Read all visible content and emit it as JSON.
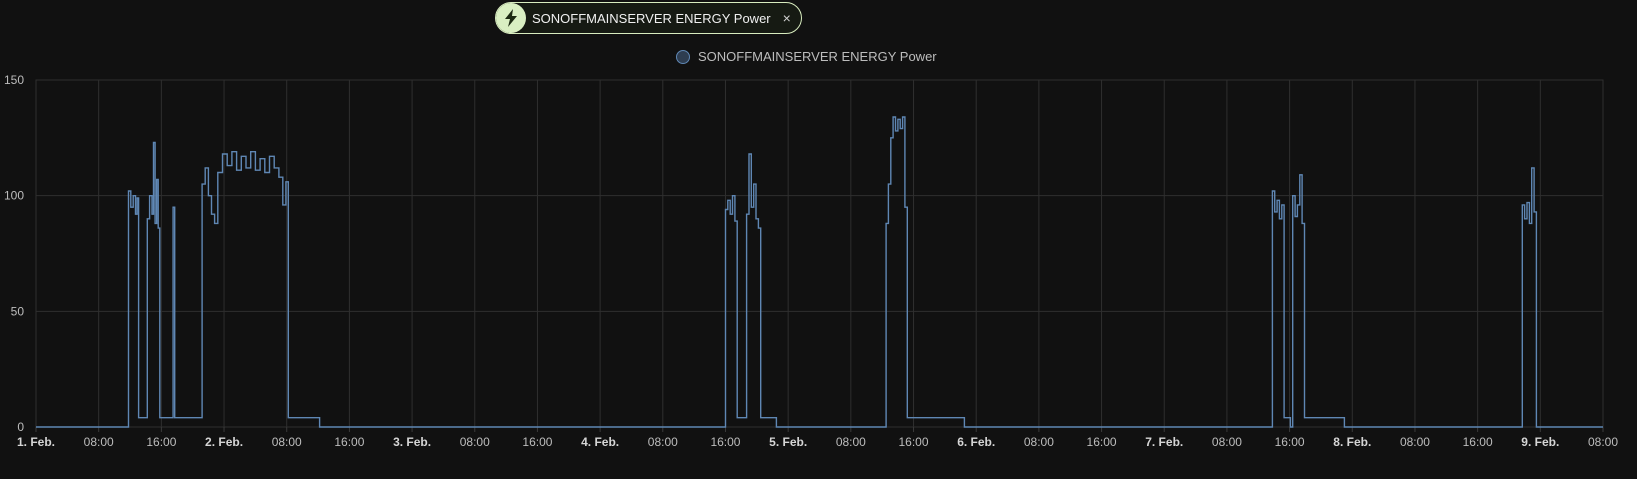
{
  "filter_chip": {
    "label": "SONOFFMAINSERVER ENERGY Power",
    "icon": "flash-icon",
    "close_label": "×",
    "accent_color": "#d9efc2"
  },
  "chart_data": {
    "type": "line",
    "step": true,
    "grid": true,
    "legend_position": "top-center",
    "ylim": [
      0,
      150
    ],
    "yticks": [
      0,
      50,
      100,
      150
    ],
    "x_unit": "hours since start of 1. Feb.",
    "xlim": [
      0,
      200
    ],
    "xticks": [
      {
        "x": 0,
        "label": "1. Feb.",
        "major": true
      },
      {
        "x": 8,
        "label": "08:00"
      },
      {
        "x": 16,
        "label": "16:00"
      },
      {
        "x": 24,
        "label": "2. Feb.",
        "major": true
      },
      {
        "x": 32,
        "label": "08:00"
      },
      {
        "x": 40,
        "label": "16:00"
      },
      {
        "x": 48,
        "label": "3. Feb.",
        "major": true
      },
      {
        "x": 56,
        "label": "08:00"
      },
      {
        "x": 64,
        "label": "16:00"
      },
      {
        "x": 72,
        "label": "4. Feb.",
        "major": true
      },
      {
        "x": 80,
        "label": "08:00"
      },
      {
        "x": 88,
        "label": "16:00"
      },
      {
        "x": 96,
        "label": "5. Feb.",
        "major": true
      },
      {
        "x": 104,
        "label": "08:00"
      },
      {
        "x": 112,
        "label": "16:00"
      },
      {
        "x": 120,
        "label": "6. Feb.",
        "major": true
      },
      {
        "x": 128,
        "label": "08:00"
      },
      {
        "x": 136,
        "label": "16:00"
      },
      {
        "x": 144,
        "label": "7. Feb.",
        "major": true
      },
      {
        "x": 152,
        "label": "08:00"
      },
      {
        "x": 160,
        "label": "16:00"
      },
      {
        "x": 168,
        "label": "8. Feb.",
        "major": true
      },
      {
        "x": 176,
        "label": "08:00"
      },
      {
        "x": 184,
        "label": "16:00"
      },
      {
        "x": 192,
        "label": "9. Feb.",
        "major": true
      },
      {
        "x": 200,
        "label": "08:00"
      }
    ],
    "series": [
      {
        "name": "SONOFFMAINSERVER ENERGY Power",
        "color": "#5f87b4",
        "points": [
          [
            0,
            0
          ],
          [
            11.8,
            0
          ],
          [
            11.8,
            102
          ],
          [
            12.1,
            95
          ],
          [
            12.4,
            100
          ],
          [
            12.7,
            92
          ],
          [
            12.9,
            99
          ],
          [
            13.1,
            4
          ],
          [
            14.2,
            4
          ],
          [
            14.2,
            90
          ],
          [
            14.5,
            100
          ],
          [
            14.8,
            92
          ],
          [
            15.0,
            123
          ],
          [
            15.2,
            88
          ],
          [
            15.4,
            107
          ],
          [
            15.6,
            86
          ],
          [
            15.8,
            4
          ],
          [
            17.5,
            4
          ],
          [
            17.5,
            95
          ],
          [
            17.7,
            4
          ],
          [
            21.2,
            4
          ],
          [
            21.2,
            105
          ],
          [
            21.6,
            112
          ],
          [
            22.0,
            100
          ],
          [
            22.4,
            92
          ],
          [
            22.8,
            88
          ],
          [
            23.2,
            110
          ],
          [
            23.8,
            118
          ],
          [
            24.4,
            113
          ],
          [
            25.0,
            119
          ],
          [
            25.6,
            111
          ],
          [
            26.2,
            117
          ],
          [
            26.8,
            112
          ],
          [
            27.4,
            119
          ],
          [
            28.0,
            111
          ],
          [
            28.6,
            116
          ],
          [
            29.2,
            110
          ],
          [
            29.8,
            117
          ],
          [
            30.4,
            112
          ],
          [
            31.0,
            108
          ],
          [
            31.5,
            96
          ],
          [
            31.9,
            106
          ],
          [
            32.2,
            4
          ],
          [
            36.2,
            4
          ],
          [
            36.2,
            0
          ],
          [
            88.0,
            0
          ],
          [
            88.0,
            94
          ],
          [
            88.3,
            98
          ],
          [
            88.6,
            92
          ],
          [
            88.9,
            100
          ],
          [
            89.2,
            89
          ],
          [
            89.5,
            4
          ],
          [
            90.7,
            4
          ],
          [
            90.7,
            92
          ],
          [
            91.0,
            118
          ],
          [
            91.3,
            95
          ],
          [
            91.6,
            105
          ],
          [
            91.9,
            90
          ],
          [
            92.2,
            86
          ],
          [
            92.5,
            4
          ],
          [
            94.5,
            4
          ],
          [
            94.5,
            0
          ],
          [
            108.5,
            0
          ],
          [
            108.5,
            88
          ],
          [
            108.8,
            105
          ],
          [
            109.1,
            125
          ],
          [
            109.4,
            134
          ],
          [
            109.7,
            128
          ],
          [
            110.0,
            133
          ],
          [
            110.3,
            129
          ],
          [
            110.6,
            134
          ],
          [
            110.9,
            95
          ],
          [
            111.2,
            4
          ],
          [
            118.5,
            4
          ],
          [
            118.5,
            0
          ],
          [
            157.8,
            0
          ],
          [
            157.8,
            102
          ],
          [
            158.1,
            93
          ],
          [
            158.4,
            98
          ],
          [
            158.7,
            90
          ],
          [
            159.0,
            96
          ],
          [
            159.3,
            4
          ],
          [
            160.1,
            4
          ],
          [
            160.1,
            0
          ],
          [
            160.4,
            0
          ],
          [
            160.4,
            100
          ],
          [
            160.7,
            91
          ],
          [
            161.0,
            96
          ],
          [
            161.3,
            109
          ],
          [
            161.6,
            88
          ],
          [
            161.9,
            4
          ],
          [
            167.0,
            4
          ],
          [
            167.0,
            0
          ],
          [
            189.7,
            0
          ],
          [
            189.7,
            96
          ],
          [
            190.0,
            90
          ],
          [
            190.3,
            97
          ],
          [
            190.6,
            88
          ],
          [
            190.9,
            112
          ],
          [
            191.2,
            93
          ],
          [
            191.5,
            0
          ],
          [
            200,
            0
          ]
        ]
      }
    ]
  }
}
